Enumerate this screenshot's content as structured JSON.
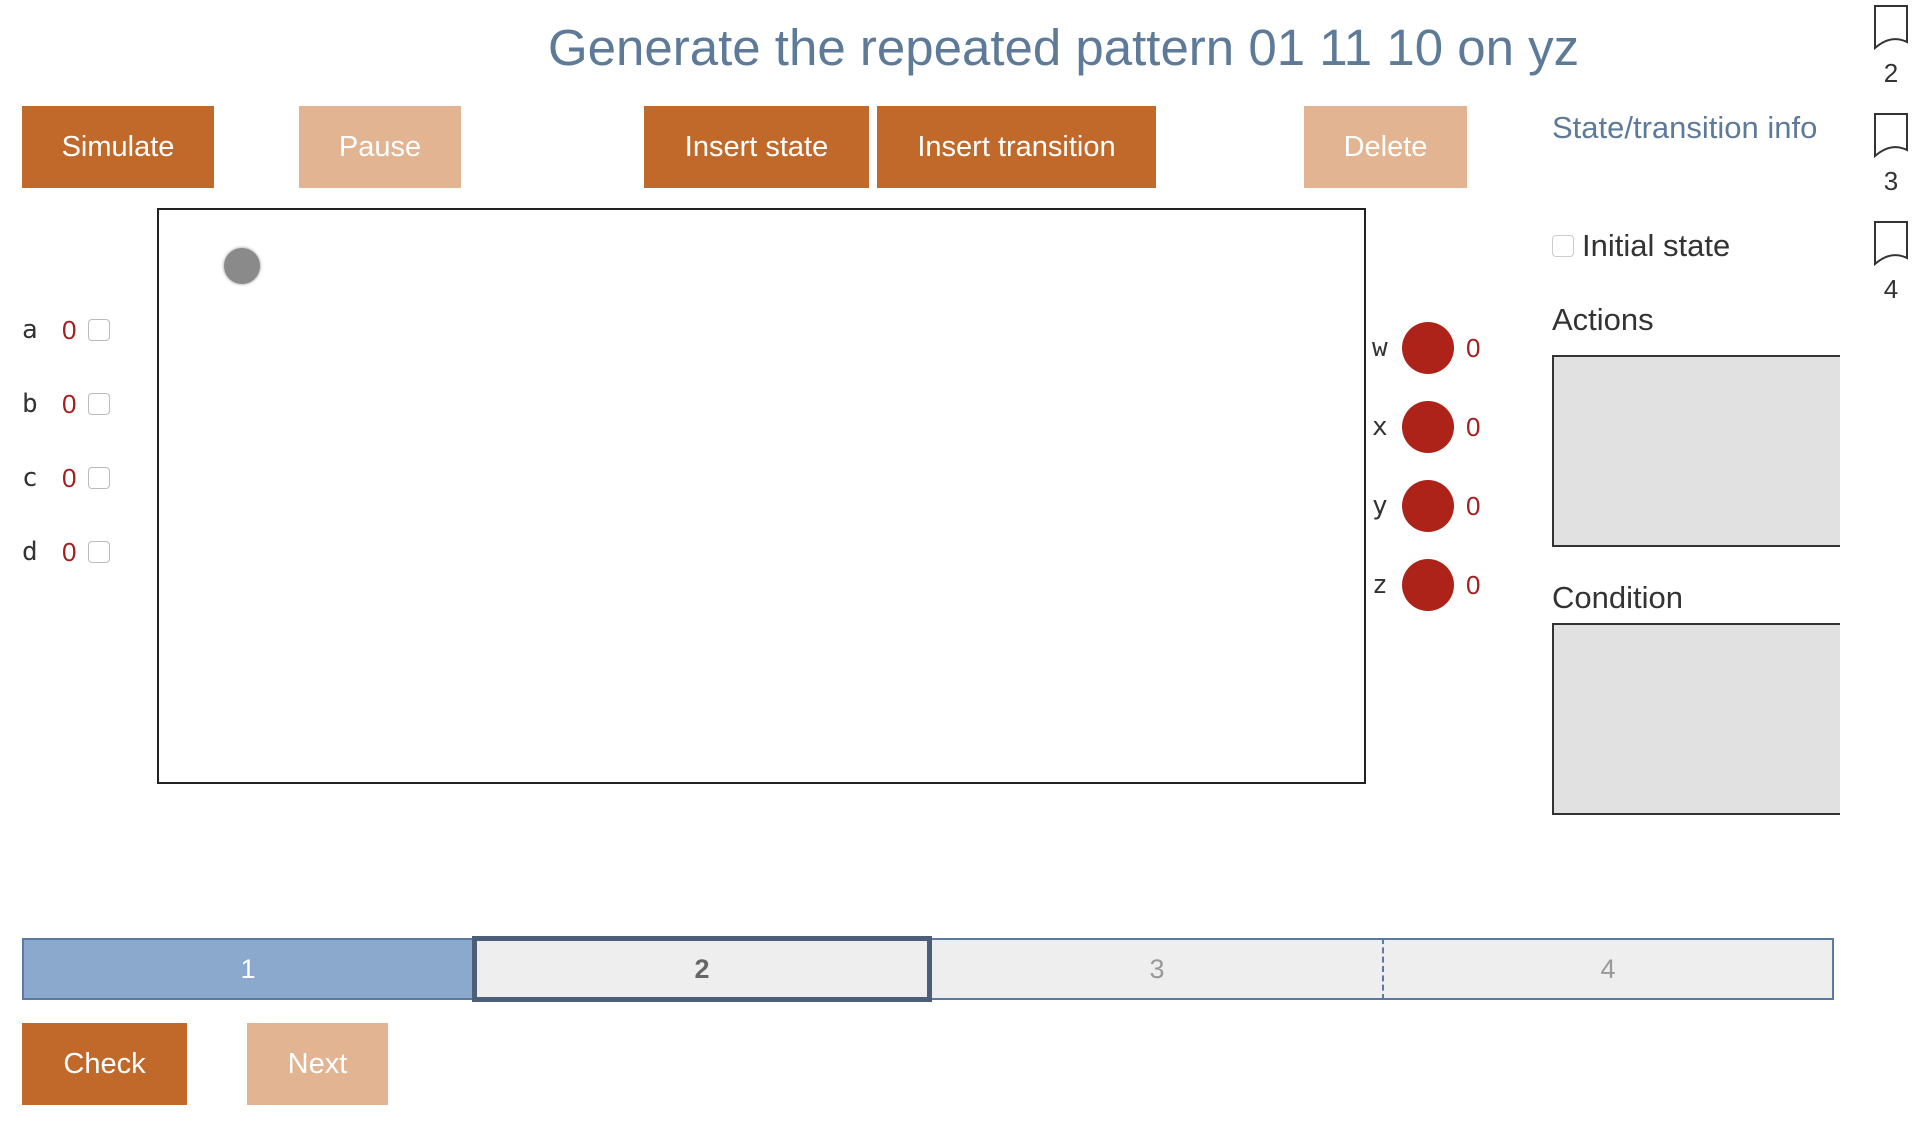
{
  "title": "Generate the repeated pattern 01 11 10 on yz",
  "toolbar": {
    "simulate": "Simulate",
    "pause": "Pause",
    "insert_state": "Insert state",
    "insert_transition": "Insert transition",
    "delete": "Delete"
  },
  "inputs": [
    {
      "name": "a",
      "value": "0"
    },
    {
      "name": "b",
      "value": "0"
    },
    {
      "name": "c",
      "value": "0"
    },
    {
      "name": "d",
      "value": "0"
    }
  ],
  "outputs": [
    {
      "name": "w",
      "value": "0"
    },
    {
      "name": "x",
      "value": "0"
    },
    {
      "name": "y",
      "value": "0"
    },
    {
      "name": "z",
      "value": "0"
    }
  ],
  "info_panel": {
    "title": "State/transition info",
    "initial_state_label": "Initial state",
    "actions_label": "Actions",
    "condition_label": "Condition"
  },
  "side_tabs": [
    "2",
    "3",
    "4"
  ],
  "progress": {
    "steps": [
      "1",
      "2",
      "3",
      "4"
    ],
    "current": 2
  },
  "footer": {
    "check": "Check",
    "next": "Next"
  },
  "colors": {
    "accent": "#c0692a",
    "accent_disabled": "#e2b491",
    "title": "#5e7a99",
    "led_off": "#ad2219"
  }
}
